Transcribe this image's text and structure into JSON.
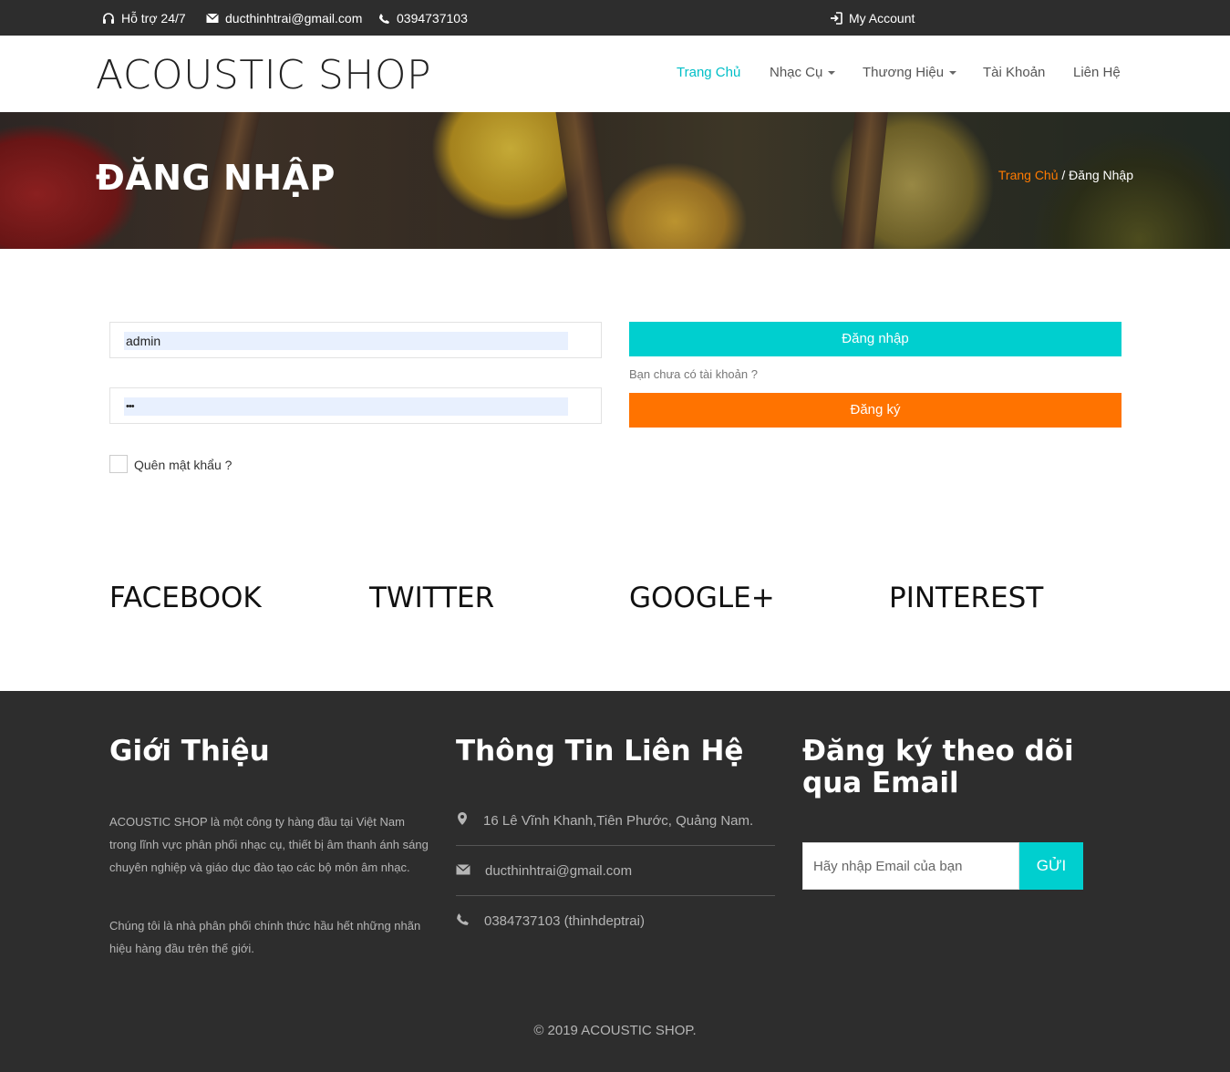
{
  "topbar": {
    "support": "Hỗ trợ 24/7",
    "email": "ducthinhtrai@gmail.com",
    "phone": "0394737103",
    "account": "My Account"
  },
  "header": {
    "logo": "ACOUSTIC SHOP",
    "nav": [
      {
        "label": "Trang Chủ",
        "active": true
      },
      {
        "label": "Nhạc Cụ",
        "dropdown": true
      },
      {
        "label": "Thương Hiệu",
        "dropdown": true
      },
      {
        "label": "Tài Khoản"
      },
      {
        "label": "Liên Hệ"
      }
    ]
  },
  "banner": {
    "title": "ĐĂNG NHẬP",
    "breadcrumb_home": "Trang Chủ",
    "breadcrumb_sep": "/",
    "breadcrumb_current": "Đăng Nhập"
  },
  "login_form": {
    "username_value": "admin",
    "password_value": "•••",
    "forgot_label": "Quên mật khẩu ?",
    "login_button": "Đăng nhập",
    "no_account_text": "Bạn chưa có tài khoản ?",
    "register_button": "Đăng ký"
  },
  "social": [
    "FACEBOOK",
    "TWITTER",
    "GOOGLE+",
    "PINTEREST"
  ],
  "footer": {
    "about_title": "Giới Thiệu",
    "about_p1": "ACOUSTIC SHOP là một công ty hàng đầu tại Việt Nam trong lĩnh vực phân phối nhạc cụ, thiết bị âm thanh ánh sáng chuyên nghiệp và giáo dục đào tạo các bộ môn âm nhạc.",
    "about_p2": "Chúng tôi là nhà phân phối chính thức hầu hết những nhãn hiệu hàng đầu trên thế giới.",
    "contact_title": "Thông Tin Liên Hệ",
    "address": "16 Lê Vĩnh Khanh,Tiên Phước, Quảng Nam.",
    "email": "ducthinhtrai@gmail.com",
    "phone": "0384737103 (thinhdeptrai)",
    "subscribe_title": "Đăng ký theo dõi qua Email",
    "subscribe_placeholder": "Hãy nhập Email của bạn",
    "subscribe_button": "GỬI",
    "copyright": "© 2019 ACOUSTIC SHOP."
  },
  "colors": {
    "accent": "#00cfcf",
    "orange": "#ff7300",
    "dark": "#2d2d2d"
  }
}
